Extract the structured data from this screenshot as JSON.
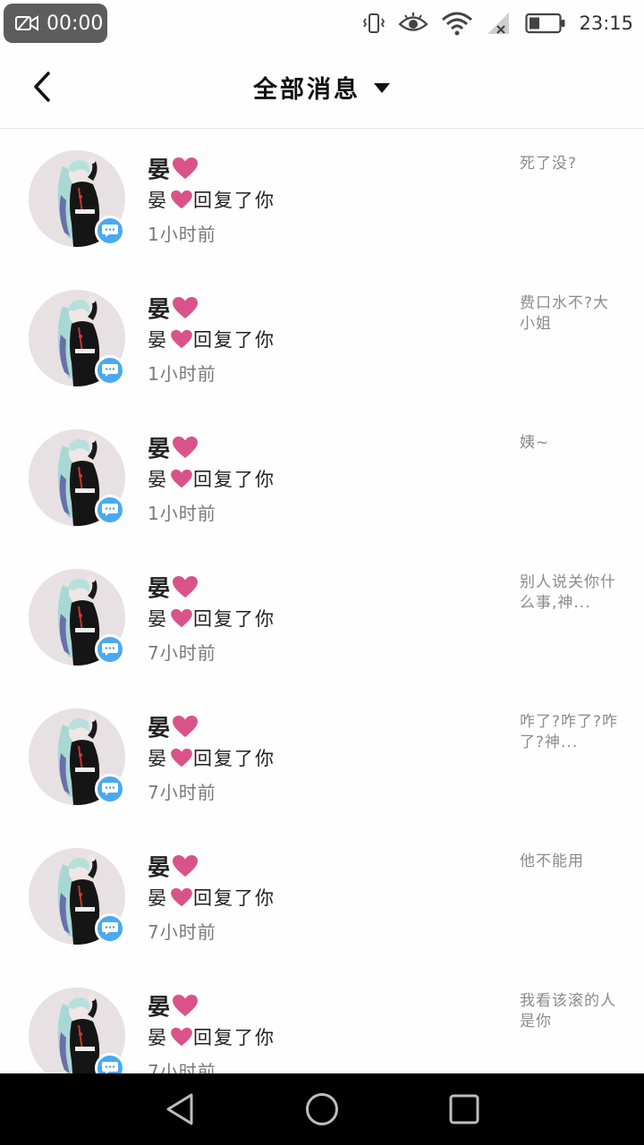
{
  "status_bar": {
    "record_time": "00:00",
    "clock": "23:15",
    "icons": [
      "vibrate-icon",
      "eye-icon",
      "wifi-icon",
      "signal-icon",
      "battery-icon"
    ]
  },
  "header": {
    "title": "全部消息"
  },
  "messages": [
    {
      "name": "晏",
      "action": "晏",
      "action_suffix": "回复了你",
      "time": "1小时前",
      "snippet": "死了没?"
    },
    {
      "name": "晏",
      "action": "晏",
      "action_suffix": "回复了你",
      "time": "1小时前",
      "snippet": "费口水不?大小姐"
    },
    {
      "name": "晏",
      "action": "晏",
      "action_suffix": "回复了你",
      "time": "1小时前",
      "snippet": "姨~"
    },
    {
      "name": "晏",
      "action": "晏",
      "action_suffix": "回复了你",
      "time": "7小时前",
      "snippet": "别人说关你什么事,神..."
    },
    {
      "name": "晏",
      "action": "晏",
      "action_suffix": "回复了你",
      "time": "7小时前",
      "snippet": "咋了?咋了?咋了?神..."
    },
    {
      "name": "晏",
      "action": "晏",
      "action_suffix": "回复了你",
      "time": "7小时前",
      "snippet": "他不能用"
    },
    {
      "name": "晏",
      "action": "晏",
      "action_suffix": "回复了你",
      "time": "7小时前",
      "snippet": "我看该滚的人是你"
    }
  ],
  "colors": {
    "heart": "#d9538a",
    "badge": "#4aa9f0",
    "avatar_bg": "#e8e1e4",
    "navbar": "#000000"
  }
}
